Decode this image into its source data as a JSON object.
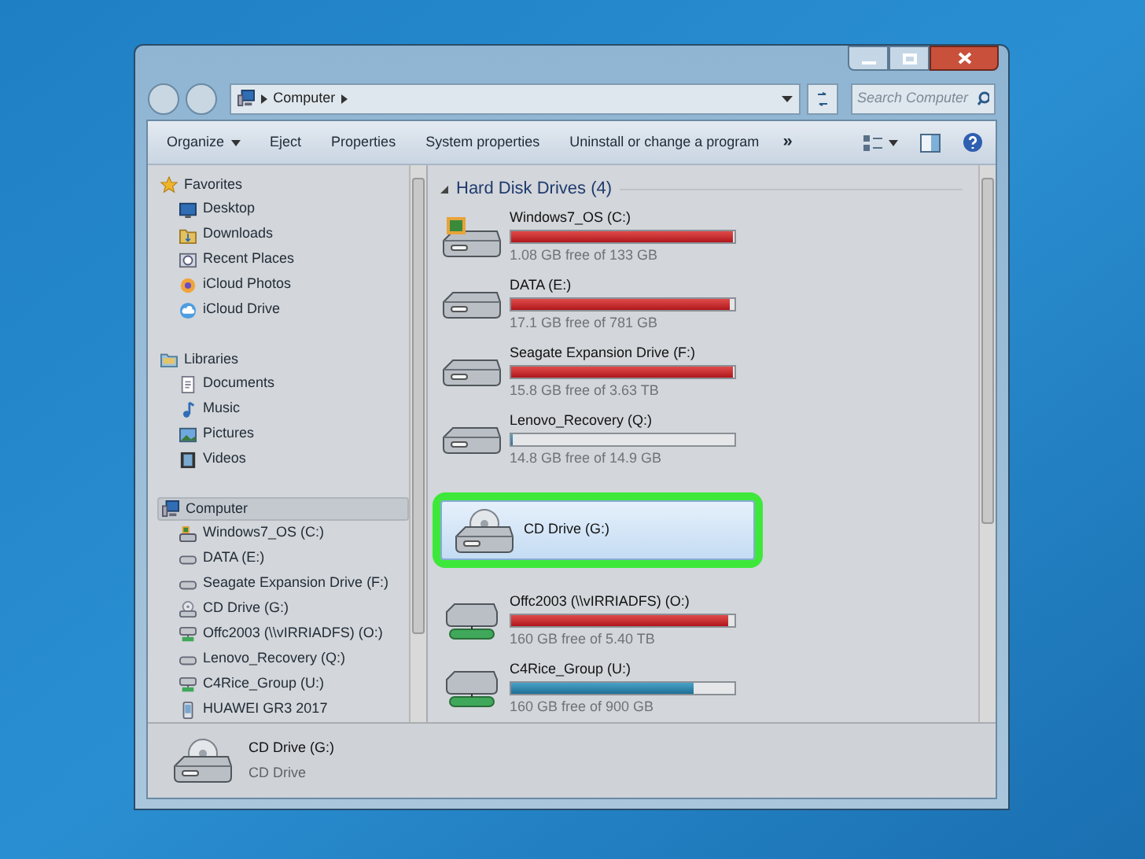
{
  "address_bar": {
    "path": [
      "Computer"
    ],
    "search_placeholder": "Search Computer"
  },
  "toolbar": {
    "items": [
      "Organize",
      "Eject",
      "Properties",
      "System properties",
      "Uninstall or change a program"
    ],
    "more": "»"
  },
  "nav_pane": {
    "groups": [
      {
        "label": "Favorites",
        "kind": "star",
        "children": [
          {
            "label": "Desktop",
            "kind": "desktop"
          },
          {
            "label": "Downloads",
            "kind": "folder"
          },
          {
            "label": "Recent Places",
            "kind": "clock"
          },
          {
            "label": "iCloud Photos",
            "kind": "photos"
          },
          {
            "label": "iCloud Drive",
            "kind": "cloud"
          }
        ]
      },
      {
        "label": "Libraries",
        "kind": "library",
        "children": [
          {
            "label": "Documents",
            "kind": "document"
          },
          {
            "label": "Music",
            "kind": "music"
          },
          {
            "label": "Pictures",
            "kind": "picture"
          },
          {
            "label": "Videos",
            "kind": "video"
          }
        ]
      },
      {
        "label": "Computer",
        "kind": "computer",
        "selected": true,
        "children": [
          {
            "label": "Windows7_OS (C:)",
            "kind": "osdrive"
          },
          {
            "label": "DATA (E:)",
            "kind": "drive"
          },
          {
            "label": "Seagate Expansion Drive (F:)",
            "kind": "drive"
          },
          {
            "label": "CD Drive (G:)",
            "kind": "cd"
          },
          {
            "label": "Offc2003 (\\\\vIRRIADFS) (O:)",
            "kind": "netdrive"
          },
          {
            "label": "Lenovo_Recovery (Q:)",
            "kind": "drive"
          },
          {
            "label": "C4Rice_Group (U:)",
            "kind": "netdrive"
          },
          {
            "label": "HUAWEI GR3 2017",
            "kind": "phone"
          }
        ]
      }
    ]
  },
  "content": {
    "sections": [
      {
        "heading": "Hard Disk Drives (4)",
        "expanded": true,
        "items": [
          {
            "name": "Windows7_OS (C:)",
            "kind": "osdrive",
            "level": 0.99,
            "free": "1.08 GB free of 133 GB"
          },
          {
            "name": "DATA (E:)",
            "kind": "drive",
            "level": 0.98,
            "free": "17.1 GB free of 781 GB"
          },
          {
            "name": "Seagate Expansion Drive (F:)",
            "kind": "drive",
            "level": 0.99,
            "free": "15.8 GB free of 3.63 TB"
          },
          {
            "name": "Lenovo_Recovery (Q:)",
            "kind": "drive",
            "level": 0.01,
            "free": "14.8 GB free of 14.9 GB"
          }
        ]
      },
      {
        "items": [
          {
            "name": "CD Drive (G:)",
            "kind": "cd",
            "selected": true,
            "highlighted": true
          }
        ]
      },
      {
        "items": [
          {
            "name": "Offc2003 (\\\\vIRRIADFS) (O:)",
            "kind": "netdrive",
            "level": 0.97,
            "free": "160 GB free of 5.40 TB"
          },
          {
            "name": "C4Rice_Group (U:)",
            "kind": "netdrive",
            "level": 0.82,
            "free": "160 GB free of 900 GB"
          }
        ]
      }
    ]
  },
  "details": {
    "name": "CD Drive (G:)",
    "type": "CD Drive",
    "kind": "cd"
  }
}
